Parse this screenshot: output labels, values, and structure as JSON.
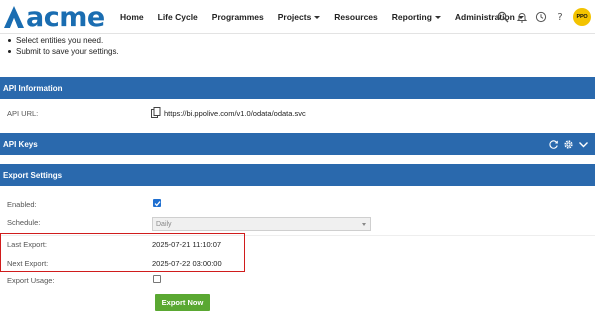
{
  "logo": {
    "text": "acme"
  },
  "nav": {
    "items": [
      {
        "label": "Home",
        "dropdown": false
      },
      {
        "label": "Life Cycle",
        "dropdown": false
      },
      {
        "label": "Programmes",
        "dropdown": false
      },
      {
        "label": "Projects",
        "dropdown": true
      },
      {
        "label": "Resources",
        "dropdown": false
      },
      {
        "label": "Reporting",
        "dropdown": true
      },
      {
        "label": "Administration",
        "dropdown": true
      }
    ],
    "icons": [
      "search-icon",
      "bell-icon",
      "clock-icon",
      "help-icon"
    ],
    "help_glyph": "?",
    "avatar_text": "PPO"
  },
  "instructions": {
    "bullets": [
      "Select entities you need.",
      "Submit to save your settings."
    ]
  },
  "api_information": {
    "title": "API Information",
    "url_label": "API URL:",
    "url_value": "https://bi.ppolive.com/v1.0/odata/odata.svc",
    "url_icon": "copy-icon"
  },
  "api_keys": {
    "title": "API Keys",
    "tool_icons": [
      "refresh-icon",
      "gear-icon",
      "chevron-down-icon"
    ]
  },
  "export_settings": {
    "title": "Export Settings",
    "enabled_label": "Enabled:",
    "enabled_checked": true,
    "schedule_label": "Schedule:",
    "schedule_value": "Daily",
    "last_export_label": "Last Export:",
    "last_export_value": "2025-07-21 11:10:07",
    "next_export_label": "Next Export:",
    "next_export_value": "2025-07-22 03:00:00",
    "export_usage_label": "Export Usage:",
    "export_usage_checked": false,
    "button_label": "Export Now"
  },
  "colors": {
    "brand": "#1a6db1",
    "section_bar": "#2a69ad",
    "button": "#5aa832",
    "highlight": "#d01c1c",
    "avatar": "#f3c300",
    "checkbox": "#1f6fd0"
  }
}
